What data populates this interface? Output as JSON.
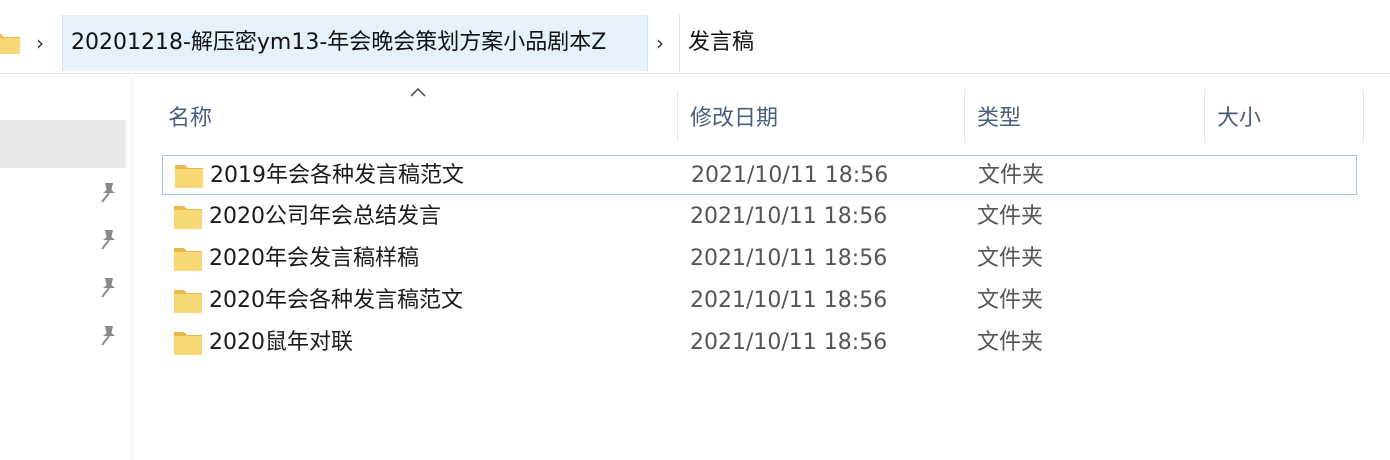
{
  "breadcrumb": {
    "items": [
      {
        "label": "20201218-解压密ym13-年会晚会策划方案小品剧本Z"
      },
      {
        "label": "发言稿"
      }
    ],
    "separator": "›"
  },
  "columns": {
    "name": "名称",
    "date_modified": "修改日期",
    "type": "类型",
    "size": "大小"
  },
  "files": [
    {
      "name": "2019年会各种发言稿范文",
      "date_modified": "2021/10/11 18:56",
      "type": "文件夹",
      "size": ""
    },
    {
      "name": "2020公司年会总结发言",
      "date_modified": "2021/10/11 18:56",
      "type": "文件夹",
      "size": ""
    },
    {
      "name": "2020年会发言稿样稿",
      "date_modified": "2021/10/11 18:56",
      "type": "文件夹",
      "size": ""
    },
    {
      "name": "2020年会各种发言稿范文",
      "date_modified": "2021/10/11 18:56",
      "type": "文件夹",
      "size": ""
    },
    {
      "name": "2020鼠年对联",
      "date_modified": "2021/10/11 18:56",
      "type": "文件夹",
      "size": ""
    }
  ],
  "colors": {
    "folder": "#f8d775",
    "folder_dark": "#e9b949",
    "selection_border": "#99c9ef",
    "crumb_active_bg": "#e5f1fb",
    "header_text": "#4a5d7e"
  },
  "icons": {
    "folder": "folder-icon",
    "pin": "pin-icon",
    "chevron": "chevron-right-icon",
    "sort": "sort-ascending-icon"
  }
}
